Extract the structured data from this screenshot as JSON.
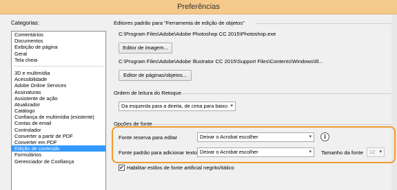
{
  "window": {
    "title": "Preferências"
  },
  "categories": {
    "label": "Categorias:",
    "group1": [
      "Comentários",
      "Documentos",
      "Exibição de página",
      "Geral",
      "Tela cheia"
    ],
    "group2": [
      "3D e multimídia",
      "Acessibilidade",
      "Adobe Online Services",
      "Assinaturas",
      "Assistente de ação",
      "Atualizador",
      "Catálogo",
      "Confiança de multimídia (existente)",
      "Contas de email",
      "Controlador",
      "Converter a partir de PDF",
      "Converter em PDF",
      "Edição de conteúdo",
      "Formulários",
      "Gerenciador de Confiança"
    ],
    "selected": "Edição de conteúdo"
  },
  "editors": {
    "title": "Editores padrão para \"Ferramenta de edição de objetos\"",
    "image_path": "C:\\Program Files\\Adobe\\Adobe Photoshop CC 2015\\Photoshop.exe",
    "image_button": "Editor de imagem...",
    "page_path": "C:\\Program Files\\Adobe\\Adobe Illustrator CC 2015\\Support Files\\Contents\\Windows\\Ill...",
    "page_button": "Editor de páginas/objetos..."
  },
  "reading_order": {
    "title": "Ordem de leitura do Retoque",
    "value": "Da esquerda para a direita, de cima para baixo"
  },
  "font_options": {
    "title": "Opções de fonte",
    "fallback_label": "Fonte reserva para editar",
    "fallback_value": "Deixar o Acrobat escolher",
    "default_label": "Fonte padrão para adicionar texto",
    "default_value": "Deixar o Acrobat escolher",
    "size_label": "Tamanho da fonte",
    "size_value": "12",
    "info_symbol": "i",
    "checkbox_label": "Habilitar estilos de fonte artificial negrito/itálico",
    "checkbox_checked": true,
    "check_mark": "✔"
  },
  "icons": {
    "dropdown_arrow": "▾"
  }
}
